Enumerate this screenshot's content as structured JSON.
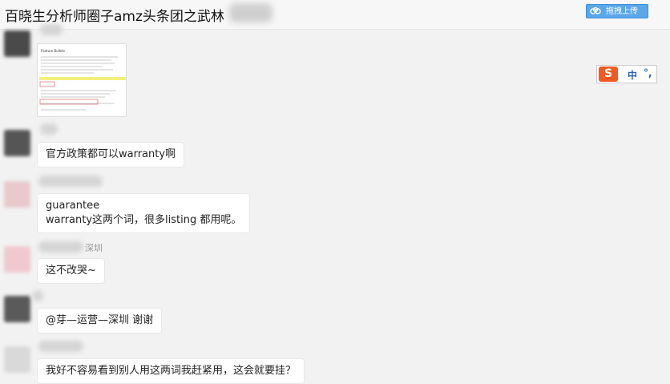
{
  "window": {
    "title": "百晓生分析师圈子amz头条团之武林",
    "upload_label": "拖拽上传"
  },
  "ime": {
    "logo": "S",
    "lang": "中",
    "punct": "°,"
  },
  "messages": [
    {
      "sender_suffix": "",
      "text": ""
    },
    {
      "sender_suffix": "",
      "text": "官方政策都可以warranty啊"
    },
    {
      "sender_suffix": "",
      "text_lines": [
        "guarantee",
        "warranty这两个词，很多listing 都用呢。"
      ]
    },
    {
      "sender_suffix": "深圳",
      "text": "这不改哭~"
    },
    {
      "sender_suffix": "",
      "text": "@芽—运营—深圳 谢谢"
    },
    {
      "sender_suffix": "",
      "text": "我好不容易看到别人用这两词我赶紧用，这会就要挂？"
    }
  ],
  "attachment": {
    "heading": "Feature Bullets"
  },
  "colors": {
    "accent": "#5aa7ea",
    "ime_brand": "#f15a22",
    "highlight": "#f3f07a"
  }
}
